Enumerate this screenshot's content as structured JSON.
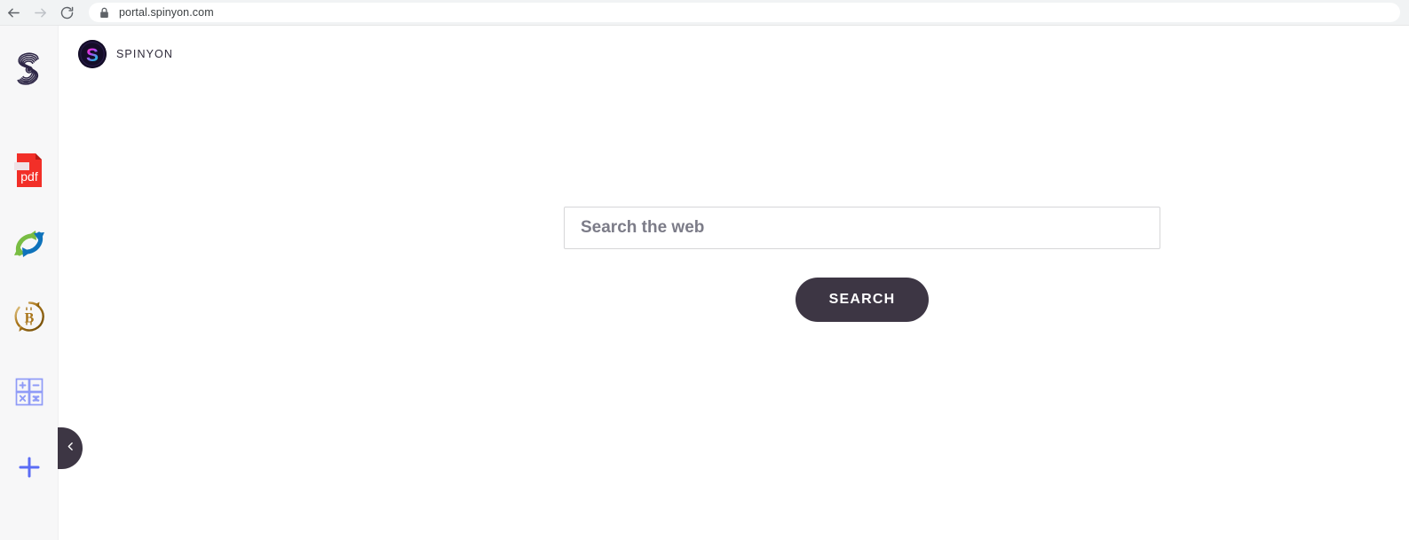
{
  "browser": {
    "back_icon": "back-arrow-icon",
    "forward_icon": "forward-arrow-icon",
    "reload_icon": "reload-icon",
    "lock_icon": "lock-icon",
    "url": "portal.spinyon.com"
  },
  "sidebar": {
    "items": [
      {
        "icon": "spinyon-spiral-logo-icon",
        "label": "Spinyon"
      },
      {
        "icon": "pdf-file-icon",
        "label": "pdf"
      },
      {
        "icon": "convert-arrows-icon",
        "label": "Convert"
      },
      {
        "icon": "bitcoin-icon",
        "label": "Bitcoin"
      },
      {
        "icon": "calculator-icon",
        "label": "Calculator"
      },
      {
        "icon": "plus-icon",
        "label": "Add"
      }
    ],
    "collapse_icon": "chevron-left-icon"
  },
  "brand": {
    "badge_icon": "spinyon-s-badge-icon",
    "name": "SPINYON"
  },
  "search": {
    "value": "",
    "placeholder": "Search the web",
    "button_label": "SEARCH"
  },
  "colors": {
    "accent_dark": "#3d3644",
    "sidebar_bg": "#f7f7f8",
    "chrome_bg": "#f1f3f4",
    "pdf_red": "#f22f28",
    "convert_green": "#79bd43",
    "convert_blue": "#0f73bb",
    "bitcoin_gold": "#b07b10",
    "calculator_blue": "#8f9bf7",
    "plus_blue": "#5b6cf5",
    "logo_pink": "#e8308f",
    "logo_cyan": "#1fc8c0"
  }
}
